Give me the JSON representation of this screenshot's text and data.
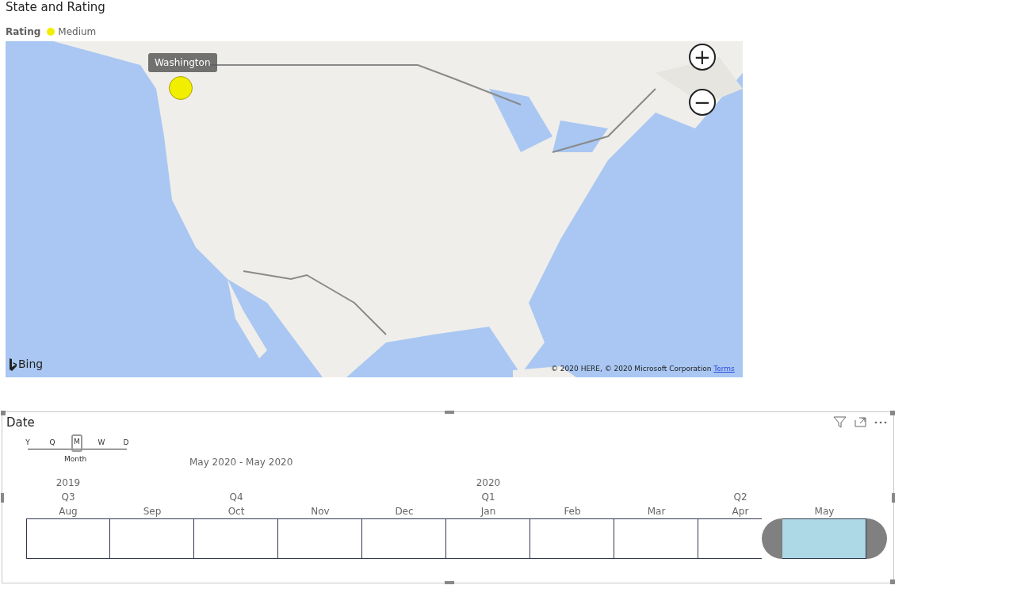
{
  "map_visual": {
    "title": "State and Rating",
    "legend": {
      "title": "Rating",
      "items": [
        {
          "label": "Medium",
          "color": "#f2ee00"
        }
      ]
    },
    "bubbles": [
      {
        "tooltip": "Washington",
        "color": "#f2ee00"
      }
    ],
    "zoom_buttons": [
      "+",
      "−"
    ],
    "logo": "Bing",
    "attribution": "© 2020 HERE, © 2020 Microsoft Corporation",
    "terms_link": "Terms"
  },
  "date_visual": {
    "title": "Date",
    "granularity": [
      {
        "label": "Y",
        "selected": false
      },
      {
        "label": "Q",
        "selected": false
      },
      {
        "label": "M",
        "selected": true
      },
      {
        "label": "W",
        "selected": false
      },
      {
        "label": "D",
        "selected": false
      }
    ],
    "granularity_caption": "Month",
    "range_label": "May 2020 - May 2020",
    "months": [
      {
        "label": "Aug",
        "year": "2019",
        "quarter": "Q3",
        "selected": false
      },
      {
        "label": "Sep",
        "selected": false
      },
      {
        "label": "Oct",
        "quarter": "Q4",
        "selected": false
      },
      {
        "label": "Nov",
        "selected": false
      },
      {
        "label": "Dec",
        "selected": false
      },
      {
        "label": "Jan",
        "year": "2020",
        "quarter": "Q1",
        "selected": false
      },
      {
        "label": "Feb",
        "selected": false
      },
      {
        "label": "Mar",
        "selected": false
      },
      {
        "label": "Apr",
        "quarter": "Q2",
        "selected": false
      },
      {
        "label": "May",
        "selected": true
      }
    ]
  }
}
